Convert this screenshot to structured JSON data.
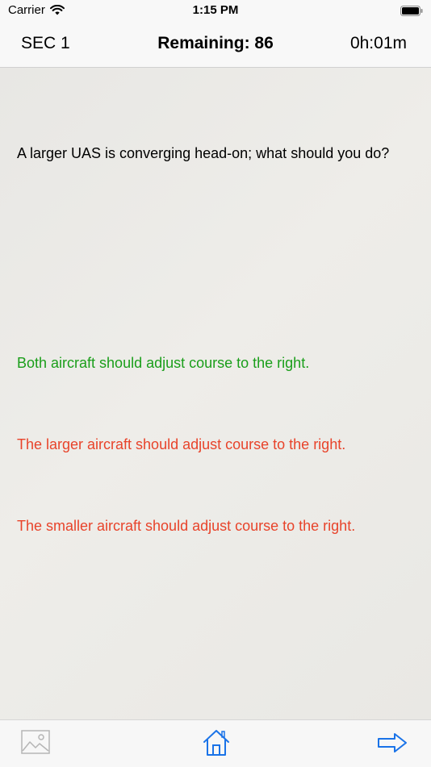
{
  "status_bar": {
    "carrier": "Carrier",
    "time": "1:15 PM",
    "wifi_icon": "wifi-icon",
    "battery_icon": "battery-icon"
  },
  "header": {
    "section": "SEC 1",
    "remaining": "Remaining: 86",
    "timer": "0h:01m"
  },
  "question": {
    "text": "A larger UAS is converging head-on; what should you do?"
  },
  "answers": [
    {
      "text": "Both aircraft should adjust course to the right.",
      "color": "#1a9e1a"
    },
    {
      "text": "The larger aircraft should adjust course to the right.",
      "color": "#e8432a"
    },
    {
      "text": "The smaller aircraft should adjust course to the right.",
      "color": "#e8432a"
    }
  ],
  "toolbar": {
    "items": [
      "image-icon",
      "home-icon",
      "next-arrow-icon"
    ],
    "accent_color": "#1a73e8",
    "disabled_color": "#b5b5b5"
  }
}
